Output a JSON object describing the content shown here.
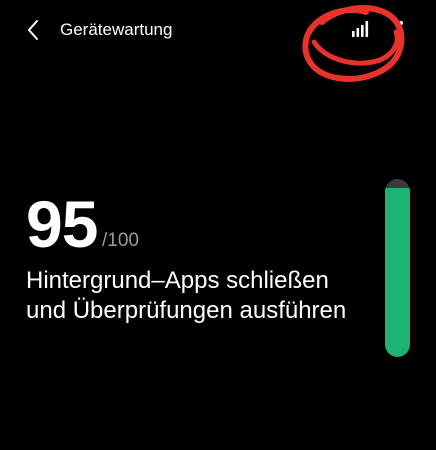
{
  "header": {
    "title": "Gerätewartung",
    "back_icon": "chevron-left-icon",
    "stats_icon": "signal-bars-icon",
    "more_icon": "more-vertical-icon"
  },
  "score": {
    "value": "95",
    "max_label": "/100",
    "fraction": 0.95
  },
  "description": "Hintergrund–Apps schließen und Überprüfungen ausführen",
  "colors": {
    "background": "#000000",
    "accent": "#1db374",
    "track": "#3a3a3a",
    "annotation": "#e8322a"
  }
}
